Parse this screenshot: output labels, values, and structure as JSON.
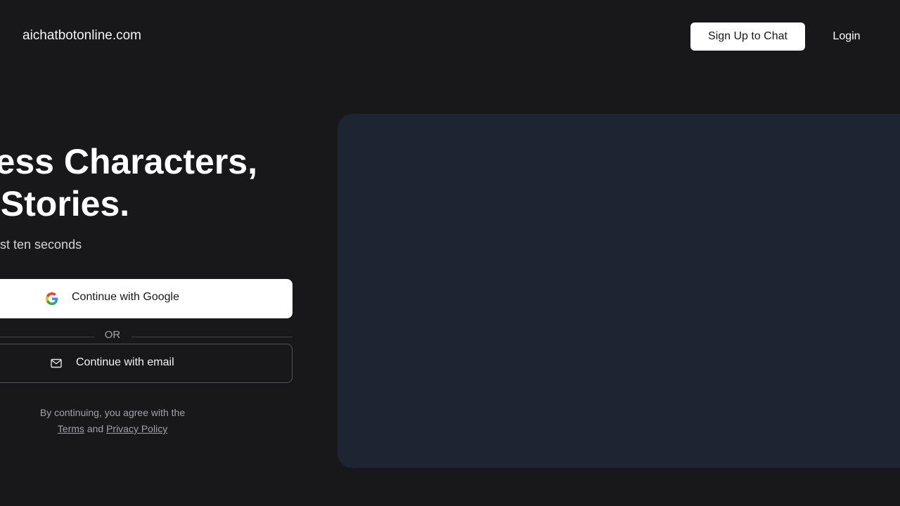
{
  "header": {
    "brand": "aichatbotonline.com",
    "signup_label": "Sign Up to Chat",
    "login_label": "Login"
  },
  "hero": {
    "headline_line1": "dless Characters,",
    "headline_line2": "nite Stories.",
    "subtitle": "ust ten seconds"
  },
  "auth": {
    "google_label": "Continue with Google",
    "or_label": "OR",
    "email_label": "Continue with email"
  },
  "legal": {
    "prefix": "By continuing, you agree with the",
    "terms": "Terms",
    "and": "and",
    "privacy": "Privacy Policy"
  },
  "colors": {
    "background": "#18181b",
    "panel": "#1e2532",
    "button_primary": "#ffffff",
    "muted_text": "#a1a1aa"
  },
  "icons": {
    "google": "google-icon",
    "email": "mail-icon"
  }
}
